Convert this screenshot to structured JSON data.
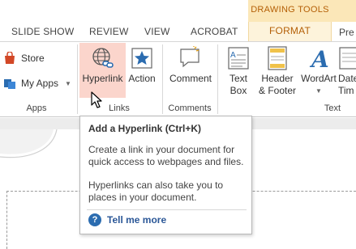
{
  "contextual": {
    "label": "DRAWING TOOLS"
  },
  "tabs": [
    {
      "label": "SLIDE SHOW"
    },
    {
      "label": "REVIEW"
    },
    {
      "label": "VIEW"
    },
    {
      "label": "ACROBAT"
    },
    {
      "label": "FORMAT"
    },
    {
      "label": "Pre"
    }
  ],
  "groups": {
    "apps": {
      "label": "Apps",
      "store": "Store",
      "my_apps": "My Apps"
    },
    "links": {
      "label": "Links",
      "hyperlink": "Hyperlink",
      "action": "Action"
    },
    "comments": {
      "label": "Comments",
      "comment": "Comment"
    },
    "text": {
      "label": "Text",
      "text_box": [
        "Text",
        "Box"
      ],
      "header_footer": [
        "Header",
        "& Footer"
      ],
      "wordart": "WordArt",
      "date_time": [
        "Date",
        "Tim"
      ]
    }
  },
  "tooltip": {
    "title": "Add a Hyperlink (Ctrl+K)",
    "paragraph1": [
      "Create a link in your document for",
      "quick access to webpages and files."
    ],
    "paragraph2": [
      "Hyperlinks can also take you to",
      "places in your document."
    ],
    "help": "Tell me more"
  },
  "colors": {
    "accent": "#b45f06",
    "contextual_band": "#fbe7b8",
    "hover_highlight": "#fbd5cc",
    "help_link": "#2b5797"
  }
}
